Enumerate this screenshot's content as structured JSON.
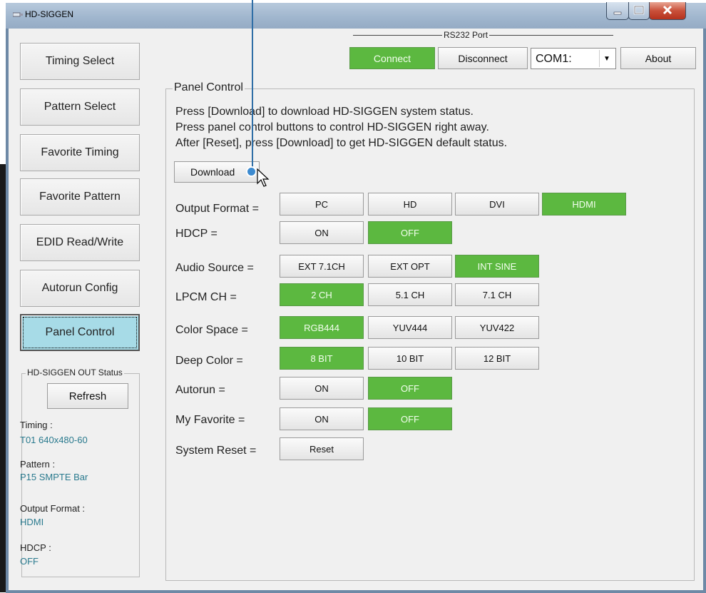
{
  "window": {
    "title": "HD-SIGGEN"
  },
  "nav": {
    "items": [
      {
        "label": "Timing Select"
      },
      {
        "label": "Pattern Select"
      },
      {
        "label": "Favorite Timing"
      },
      {
        "label": "Favorite Pattern"
      },
      {
        "label": "EDID Read/Write"
      },
      {
        "label": "Autorun Config"
      },
      {
        "label": "Panel Control"
      }
    ],
    "active": "Panel Control"
  },
  "status": {
    "group_label": "HD-SIGGEN OUT Status",
    "refresh_label": "Refresh",
    "timing_label": "Timing :",
    "timing_value": "T01 640x480-60",
    "pattern_label": "Pattern :",
    "pattern_value": "P15 SMPTE Bar",
    "output_label": "Output Format :",
    "output_value": "HDMI",
    "hdcp_label": "HDCP :",
    "hdcp_value": "OFF"
  },
  "rs232": {
    "group_label": "RS232 Port",
    "connect_label": "Connect",
    "disconnect_label": "Disconnect",
    "port_value": "COM1:",
    "about_label": "About"
  },
  "panel": {
    "group_label": "Panel Control",
    "lines": [
      "Press [Download] to download HD-SIGGEN system status.",
      "Press panel control buttons to control HD-SIGGEN right away.",
      "After [Reset], press [Download] to get HD-SIGGEN default status."
    ],
    "download_label": "Download",
    "rows": {
      "output_format": {
        "label": "Output Format =",
        "options": [
          "PC",
          "HD",
          "DVI",
          "HDMI"
        ],
        "selected": "HDMI"
      },
      "hdcp": {
        "label": "HDCP =",
        "options": [
          "ON",
          "OFF"
        ],
        "selected": "OFF"
      },
      "audio_source": {
        "label": "Audio Source =",
        "options": [
          "EXT 7.1CH",
          "EXT OPT",
          "INT SINE"
        ],
        "selected": "INT SINE"
      },
      "lpcm": {
        "label": "LPCM CH =",
        "options": [
          "2 CH",
          "5.1 CH",
          "7.1 CH"
        ],
        "selected": "2 CH"
      },
      "color_space": {
        "label": "Color Space =",
        "options": [
          "RGB444",
          "YUV444",
          "YUV422"
        ],
        "selected": "RGB444"
      },
      "deep_color": {
        "label": "Deep Color =",
        "options": [
          "8 BIT",
          "10 BIT",
          "12 BIT"
        ],
        "selected": "8 BIT"
      },
      "autorun": {
        "label": "Autorun =",
        "options": [
          "ON",
          "OFF"
        ],
        "selected": "OFF"
      },
      "my_favorite": {
        "label": "My Favorite =",
        "options": [
          "ON",
          "OFF"
        ],
        "selected": "OFF"
      },
      "system_reset": {
        "label": "System Reset =",
        "options": [
          "Reset"
        ]
      }
    }
  },
  "colors": {
    "selected_green": "#5cb840",
    "active_nav": "#a7dbe7",
    "status_value": "#2a7a8e",
    "annotation": "#3d8bd0"
  }
}
